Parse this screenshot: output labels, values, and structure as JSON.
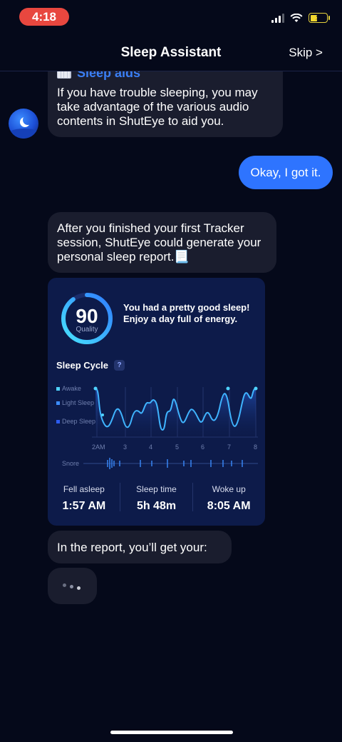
{
  "status_bar": {
    "time": "4:18"
  },
  "header": {
    "title": "Sleep Assistant",
    "skip_label": "Skip >"
  },
  "messages": {
    "aids_title": "Sleep aids",
    "aids_text": "If you have trouble sleeping, you may take advantage of the various audio contents in ShutEye to aid you.",
    "user_reply": "Okay, I got it.",
    "report_intro": "After you finished your first Tracker session, ShutEye could generate your personal sleep report.📃",
    "report_next": "In the report, you’ll get your:"
  },
  "report_card": {
    "score": "90",
    "score_label": "Quality",
    "score_text": "You had a pretty good sleep! Enjoy a day full of energy.",
    "cycle_title": "Sleep Cycle",
    "help": "?",
    "legend": [
      "Awake",
      "Light Sleep",
      "Deep Sleep"
    ],
    "x_ticks": [
      "2AM",
      "3",
      "4",
      "5",
      "6",
      "7",
      "8"
    ],
    "snore_label": "Snore",
    "stats": [
      {
        "label": "Fell asleep",
        "value": "1:57 AM"
      },
      {
        "label": "Sleep time",
        "value": "5h 48m"
      },
      {
        "label": "Woke up",
        "value": "8:05 AM"
      }
    ]
  },
  "colors": {
    "background": "#05091a",
    "bubble": "#1a1d2e",
    "user_bubble": "#2e74ff",
    "card": "#0d1b4a",
    "accent": "#3b7ff5",
    "awake": "#4fd3ff",
    "light_sleep": "#3b8cff",
    "deep_sleep": "#2c5cf0"
  }
}
